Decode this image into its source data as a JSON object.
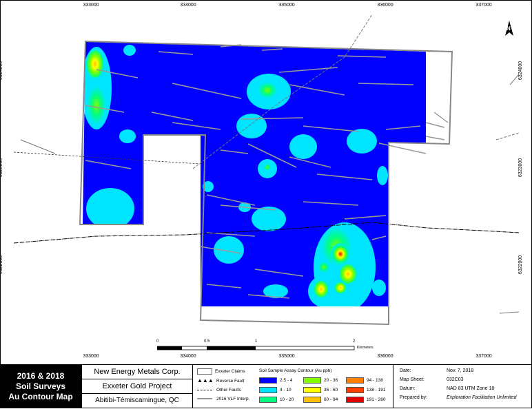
{
  "axis_ticks": {
    "easting": [
      "333000",
      "334000",
      "335000",
      "336000",
      "337000"
    ],
    "northing": [
      "6324000",
      "6323000",
      "6322000"
    ]
  },
  "scale_bar": {
    "labels": [
      "0",
      "0.5",
      "1",
      "2"
    ],
    "unit": "Kilometers"
  },
  "title_block": {
    "line1": "2016 & 2018",
    "line2": "Soil Surveys",
    "line3": "Au Contour Map"
  },
  "company_block": {
    "company": "New Energy Metals Corp.",
    "project": "Exxeter Gold Project",
    "region": "Abitibi-Témiscamingue, QC"
  },
  "legend": {
    "claims": "Exxeter Claims",
    "reverse_fault": "Reverse Fault",
    "other_faults": "Other Faults",
    "vlf": "2016 VLF Interp.",
    "contour_title": "Soil Sample Assay Contour (Au ppb)",
    "classes": [
      {
        "label": "2.5 - 4",
        "color": "#0000ff"
      },
      {
        "label": "4 - 10",
        "color": "#00e5ff"
      },
      {
        "label": "10 - 20",
        "color": "#00ff80"
      },
      {
        "label": "20 - 36",
        "color": "#80ff00"
      },
      {
        "label": "36 - 60",
        "color": "#ffff00"
      },
      {
        "label": "60 - 94",
        "color": "#ffc000"
      },
      {
        "label": "94 - 138",
        "color": "#ff8000"
      },
      {
        "label": "138 - 191",
        "color": "#ff4000"
      },
      {
        "label": "191 - 260",
        "color": "#e00000"
      }
    ]
  },
  "map_info": {
    "date_label": "Date:",
    "date": "Nov. 7, 2018",
    "sheet_label": "Map Sheet:",
    "sheet": "032C03",
    "datum_label": "Datum:",
    "datum": "NAD 83 UTM Zone 18",
    "prepared_label": "Prepared by:",
    "prepared": "Exploration Facilitation Unlimited"
  },
  "north_arrow": "N"
}
